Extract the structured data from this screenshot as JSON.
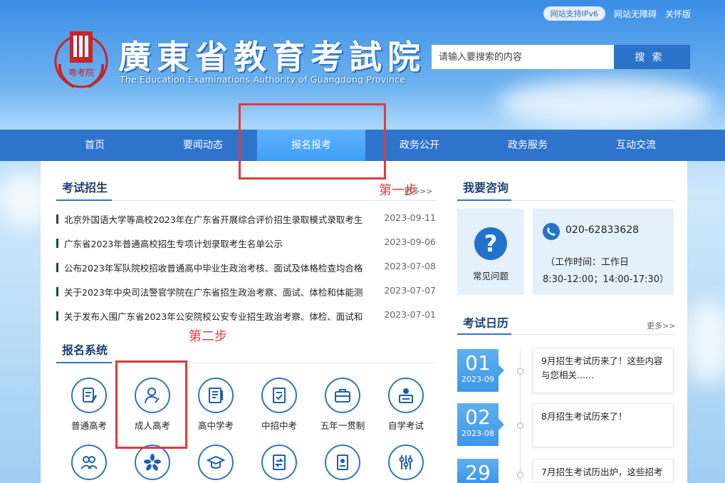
{
  "header": {
    "top_links": [
      "网站支持IPv6",
      "网站无障碍",
      "关怀版"
    ],
    "logo_seal_text": "粤考院",
    "title": "廣東省教育考試院",
    "subtitle": "The Education Examinations Authority of Guangdong Province",
    "search_placeholder": "请输入要搜索的内容",
    "search_label": "搜索"
  },
  "nav": {
    "items": [
      "首页",
      "要闻动态",
      "报名报考",
      "政务公开",
      "政务服务",
      "互动交流"
    ],
    "active_index": 2
  },
  "exam_enrollment": {
    "title": "考试招生",
    "more": "更多>>",
    "news": [
      {
        "title": "北京外国语大学等高校2023年在广东省开展综合评价招生录取模式录取考生...",
        "date": "2023-09-11"
      },
      {
        "title": "广东省2023年普通高校招生专项计划录取考生名单公示",
        "date": "2023-09-06"
      },
      {
        "title": "公布2023年军队院校招收普通高中毕业生政治考核、面试及体格检查均合格...",
        "date": "2023-07-08"
      },
      {
        "title": "关于2023年中央司法警官学院在广东省招生政治考察、面试、体检和体能测...",
        "date": "2023-07-07"
      },
      {
        "title": "关于发布入围广东省2023年公安院校公安专业招生政治考察、体检、面试和...",
        "date": "2023-07-01"
      }
    ]
  },
  "registration_system": {
    "title": "报名系统",
    "items": [
      {
        "label": "普通高考",
        "icon": "exam-paper-icon"
      },
      {
        "label": "成人高考",
        "icon": "adult-person-icon"
      },
      {
        "label": "高中学考",
        "icon": "book-icon"
      },
      {
        "label": "中招中考",
        "icon": "document-icon"
      },
      {
        "label": "五年一贯制",
        "icon": "briefcase-icon"
      },
      {
        "label": "自学考试",
        "icon": "self-study-icon"
      }
    ],
    "second_row_icons": [
      "people-group-icon",
      "bauhinia-icon",
      "graduation-cap-icon",
      "transfer-doc-icon",
      "certificate-icon",
      "settings-sliders-icon"
    ]
  },
  "consult": {
    "title": "我要咨询",
    "faq_label": "常见问题",
    "phone": "020-62833628",
    "work_hours_label": "（工作时间：工作日",
    "work_hours": "8:30-12:00；14:00-17:30）"
  },
  "calendar": {
    "title": "考试日历",
    "more": "更多>>",
    "entries": [
      {
        "day": "01",
        "ym": "2023-09",
        "text": "9月招生考试历来了！这些内容与您相关......"
      },
      {
        "day": "02",
        "ym": "2023-08",
        "text": "8月招生考试历来了！"
      },
      {
        "day": "29",
        "ym": "",
        "text": "7月招生考试历出炉，这些招考"
      }
    ]
  },
  "annotations": {
    "step1": "第一步",
    "step2": "第二步",
    "color": "#e23a3a"
  },
  "colors": {
    "nav_bg": "#2e74cc",
    "nav_active": "#3d9ef8",
    "title_text": "#1d3f72"
  }
}
